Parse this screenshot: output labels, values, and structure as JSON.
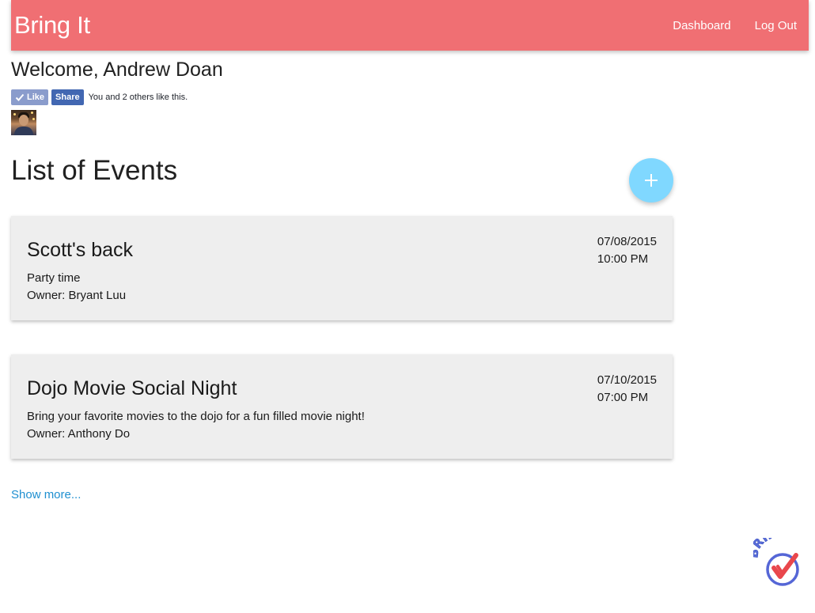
{
  "navbar": {
    "brand": "Bring It",
    "links": [
      {
        "label": "Dashboard"
      },
      {
        "label": "Log Out"
      }
    ],
    "color": "#f06f73"
  },
  "welcome": "Welcome, Andrew Doan",
  "social": {
    "like_label": "Like",
    "share_label": "Share",
    "like_text": "You and 2 others like this."
  },
  "events": {
    "heading": "List of Events",
    "add_button": "+",
    "items": [
      {
        "title": "Scott's back",
        "description": "Party time",
        "owner": "Owner: Bryant Luu",
        "date": "07/08/2015",
        "time": "10:00 PM"
      },
      {
        "title": "Dojo Movie Social Night",
        "description": "Bring your favorite movies to the dojo for a fun filled movie night!",
        "owner": "Owner: Anthony Do",
        "date": "07/10/2015",
        "time": "07:00 PM"
      }
    ],
    "show_more": "Show more..."
  },
  "logo": {
    "text": "BRING"
  },
  "colors": {
    "accent": "#f06f73",
    "fab": "#80d8ff",
    "link": "#1e8fd0",
    "card": "#eeeeee"
  }
}
